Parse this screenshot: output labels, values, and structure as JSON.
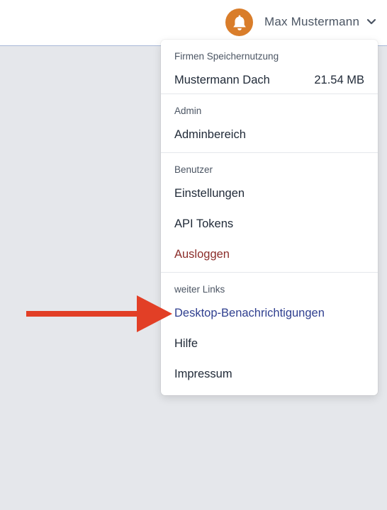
{
  "header": {
    "user_name": "Max Mustermann",
    "notification_icon": "bell-icon",
    "chevron_icon": "chevron-down-icon"
  },
  "dropdown": {
    "storage": {
      "heading": "Firmen Speichernutzung",
      "company_name": "Mustermann Dach",
      "usage": "21.54 MB"
    },
    "admin": {
      "heading": "Admin",
      "items": [
        "Adminbereich"
      ]
    },
    "user": {
      "heading": "Benutzer",
      "items": [
        "Einstellungen",
        "API Tokens",
        "Ausloggen"
      ]
    },
    "links": {
      "heading": "weiter Links",
      "items": [
        "Desktop-Benachrichtigungen",
        "Hilfe",
        "Impressum"
      ]
    }
  },
  "colors": {
    "accent_orange": "#d97d2a",
    "logout_red": "#8b2d2a",
    "link_blue": "#2f3f8f",
    "annotation_arrow": "#e23f26",
    "page_background": "#e5e7eb"
  }
}
